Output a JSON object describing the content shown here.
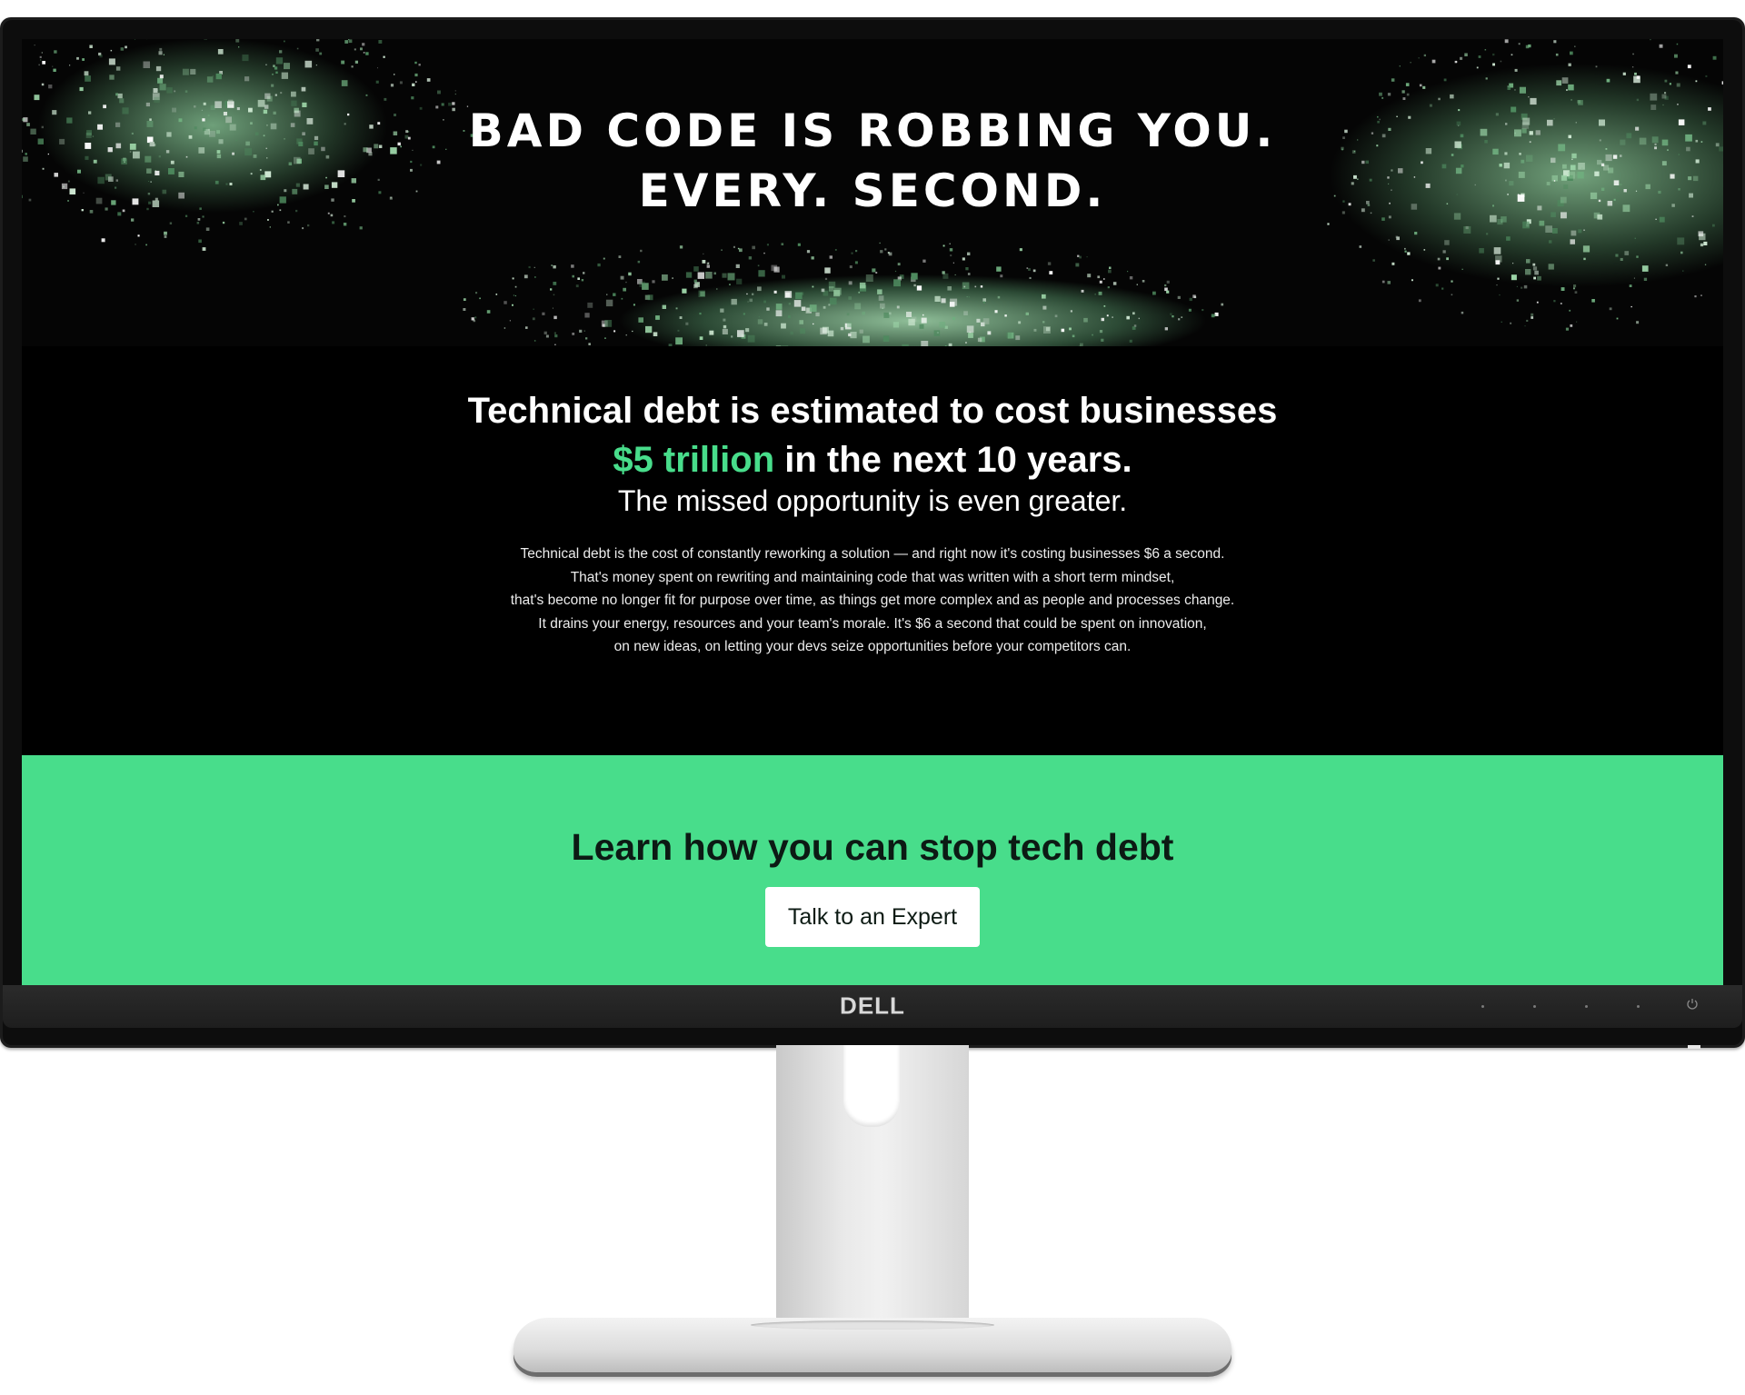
{
  "hero": {
    "title_line1": "BAD CODE IS ROBBING YOU.",
    "title_line2": "EVERY. SECOND."
  },
  "intro": {
    "headline_line1": "Technical debt is estimated to cost businesses",
    "headline_accent": "$5 trillion",
    "headline_rest": "in the next 10 years.",
    "subheadline": "The missed opportunity is even greater.",
    "body": [
      "Technical debt is the cost of constantly reworking a solution — and right now it's costing businesses $6 a second.",
      "That's money spent on rewriting and maintaining code that was written with a short term mindset,",
      "that's become no longer fit for purpose over time, as things get more complex and as people and processes change.",
      "It drains your energy, resources and your team's morale. It's $6 a second that could be spent on innovation,",
      "on new ideas, on letting your devs seize opportunities before your competitors can."
    ]
  },
  "cta": {
    "title": "Learn how you can stop tech debt",
    "button_label": "Talk to an Expert"
  },
  "monitor": {
    "brand": "DELL"
  },
  "colors": {
    "accent_green": "#48dd8b",
    "page_black": "#000000",
    "monitor_bezel": "#1c1c1c"
  },
  "icons": {
    "power": "power-icon"
  }
}
